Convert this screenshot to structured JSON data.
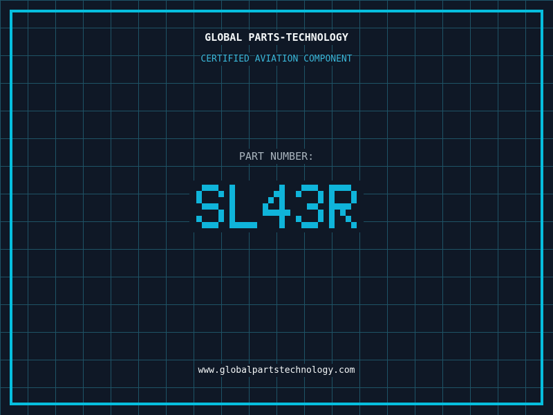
{
  "colors": {
    "bg": "#0f1826",
    "grid": "#1e5366",
    "frame": "#06bede",
    "text_white": "#f2f5f6",
    "accent_cyan": "#3ab7d9",
    "label_gray": "#a9b4bd",
    "number_cyan": "#0fb4da"
  },
  "header": {
    "company": "GLOBAL PARTS-TECHNOLOGY",
    "certification": "CERTIFIED AVIATION COMPONENT"
  },
  "part": {
    "label": "PART NUMBER:",
    "value": "SL43R"
  },
  "footer": {
    "website": "www.globalpartstechnology.com"
  }
}
